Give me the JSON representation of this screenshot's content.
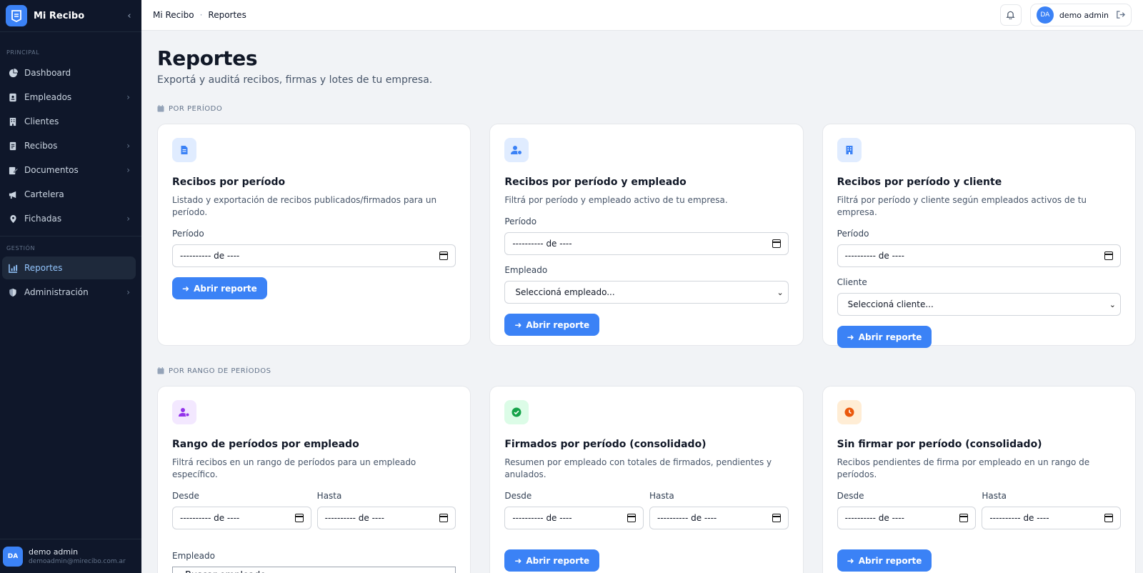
{
  "app": {
    "name": "Mi Recibo"
  },
  "sidebar": {
    "sections": [
      {
        "label": "PRINCIPAL"
      },
      {
        "label": "GESTIÓN"
      }
    ],
    "items": [
      {
        "label": "Dashboard",
        "icon": "dashboard-icon"
      },
      {
        "label": "Empleados",
        "icon": "employee-badge-icon"
      },
      {
        "label": "Clientes",
        "icon": "building-icon"
      },
      {
        "label": "Recibos",
        "icon": "receipt-icon"
      },
      {
        "label": "Documentos",
        "icon": "document-edit-icon"
      },
      {
        "label": "Cartelera",
        "icon": "megaphone-icon"
      },
      {
        "label": "Fichadas",
        "icon": "map-pin-icon"
      },
      {
        "label": "Reportes",
        "icon": "chart-icon",
        "active": true
      },
      {
        "label": "Administración",
        "icon": "shield-icon"
      }
    ],
    "user": {
      "initials": "DA",
      "name": "demo admin",
      "email": "demoadmin@mirecibo.com.ar"
    }
  },
  "topbar": {
    "breadcrumb": [
      "Mi Recibo",
      "Reportes"
    ],
    "user": {
      "initials": "DA",
      "name": "demo admin"
    }
  },
  "page": {
    "title": "Reportes",
    "subtitle": "Exportá y auditá recibos, firmas y lotes de tu empresa."
  },
  "groups": [
    {
      "label": "POR PERÍODO",
      "cards": [
        {
          "title": "Recibos por período",
          "desc": "Listado y exportación de recibos publicados/firmados para un período.",
          "period_label": "Período",
          "period_value": "---------- de ----",
          "button": "Abrir reporte"
        },
        {
          "title": "Recibos por período y empleado",
          "desc": "Filtrá por período y empleado activo de tu empresa.",
          "period_label": "Período",
          "period_value": "---------- de ----",
          "select_label": "Empleado",
          "select_value": "Seleccioná empleado...",
          "button": "Abrir reporte"
        },
        {
          "title": "Recibos por período y cliente",
          "desc": "Filtrá por período y cliente según empleados activos de tu empresa.",
          "period_label": "Período",
          "period_value": "---------- de ----",
          "select_label": "Cliente",
          "select_value": "Seleccioná cliente...",
          "button": "Abrir reporte"
        }
      ]
    },
    {
      "label": "POR RANGO DE PERÍODOS",
      "cards": [
        {
          "title": "Rango de períodos por empleado",
          "desc": "Filtrá recibos en un rango de períodos para un empleado específico.",
          "from_label": "Desde",
          "from_value": "---------- de ----",
          "to_label": "Hasta",
          "to_value": "---------- de ----",
          "employee_label": "Empleado",
          "employee_placeholder": "Buscar empleado..."
        },
        {
          "title": "Firmados por período (consolidado)",
          "desc": "Resumen por empleado con totales de firmados, pendientes y anulados.",
          "from_label": "Desde",
          "from_value": "---------- de ----",
          "to_label": "Hasta",
          "to_value": "---------- de ----",
          "button": "Abrir reporte"
        },
        {
          "title": "Sin firmar por período (consolidado)",
          "desc": "Recibos pendientes de firma por empleado en un rango de períodos.",
          "from_label": "Desde",
          "from_value": "---------- de ----",
          "to_label": "Hasta",
          "to_value": "---------- de ----",
          "button": "Abrir reporte"
        }
      ]
    }
  ],
  "colors": {
    "accent": "#3b82f6",
    "sidebar": "#0f172a",
    "background": "#f1f3f6"
  }
}
